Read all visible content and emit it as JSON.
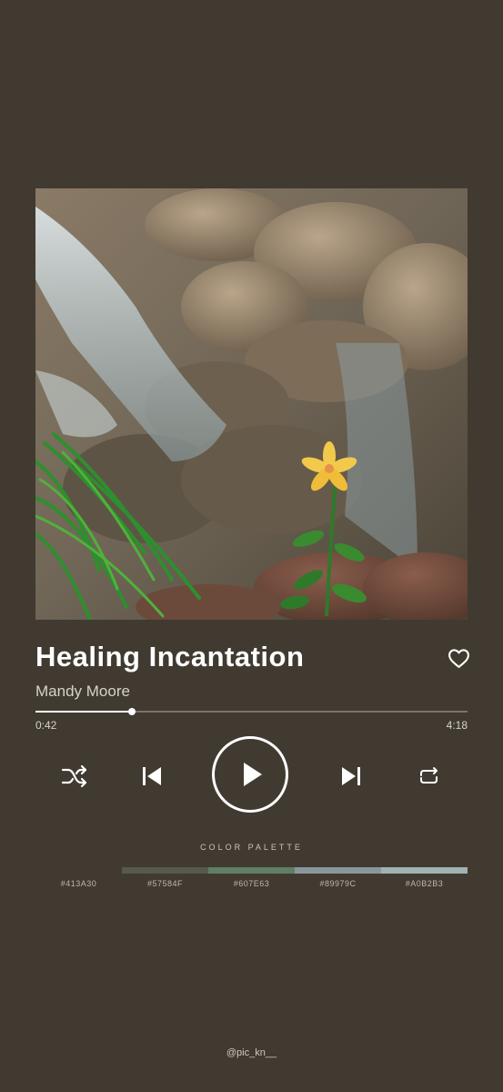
{
  "track": {
    "title": "Healing Incantation",
    "artist": "Mandy Moore",
    "liked": false
  },
  "playback": {
    "elapsed": "0:42",
    "total": "4:18",
    "progress_fraction": 0.224
  },
  "icons": {
    "favorite": "heart-outline-icon",
    "shuffle": "shuffle-icon",
    "previous": "skip-previous-icon",
    "play": "play-icon",
    "next": "skip-next-icon",
    "repeat": "repeat-icon"
  },
  "palette": {
    "title": "COLOR PALETTE",
    "colors": [
      {
        "hex": "#413A30",
        "label": "#413A30"
      },
      {
        "hex": "#57584F",
        "label": "#57584F"
      },
      {
        "hex": "#607E63",
        "label": "#607E63"
      },
      {
        "hex": "#89979C",
        "label": "#89979C"
      },
      {
        "hex": "#A0B2B3",
        "label": "#A0B2B3"
      }
    ]
  },
  "credit": "@pic_kn__",
  "colors": {
    "background": "#413A30",
    "text": "#FFFFFF",
    "flower": "#F2C94C"
  }
}
